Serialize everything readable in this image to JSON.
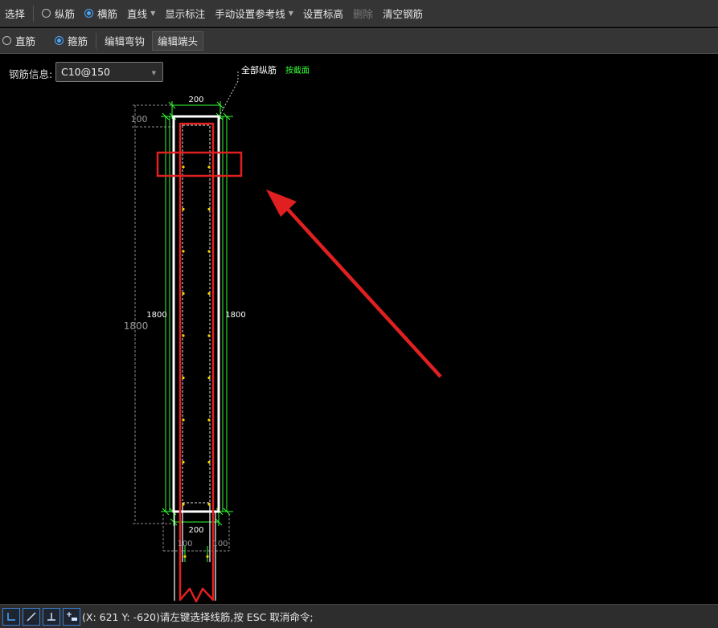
{
  "toolbar1": {
    "select": "选择",
    "longitudinal": "纵筋",
    "transverse": "横筋",
    "straight": "直线",
    "show_label": "显示标注",
    "manual_ref": "手动设置参考线",
    "set_elevation": "设置标高",
    "delete": "删除",
    "clear_rebar": "清空钢筋"
  },
  "toolbar2": {
    "straight_bar": "直筋",
    "stirrup": "箍筋",
    "edit_hook": "编辑弯钩",
    "edit_end": "编辑端头"
  },
  "rebar_info": {
    "label": "钢筋信息:",
    "value": "C10@150"
  },
  "drawing": {
    "all_longitudinal": "全部纵筋",
    "by_section": "按截面",
    "dim_width_top": "200",
    "dim_width_bottom": "200",
    "dim_left_cover": "100",
    "dim_bottom_left": "100",
    "dim_bottom_right": "100",
    "dim_height_left": "1800",
    "dim_height_right": "1800",
    "dim_height_outer": "1800"
  },
  "colors": {
    "dimension": "#33ff33",
    "outline": "#ffffff",
    "highlight": "#e02020",
    "rebar_point": "#ffd400"
  },
  "statusbar": {
    "text": "(X: 621 Y: -620)请左键选择线筋,按 ESC 取消命令;"
  }
}
